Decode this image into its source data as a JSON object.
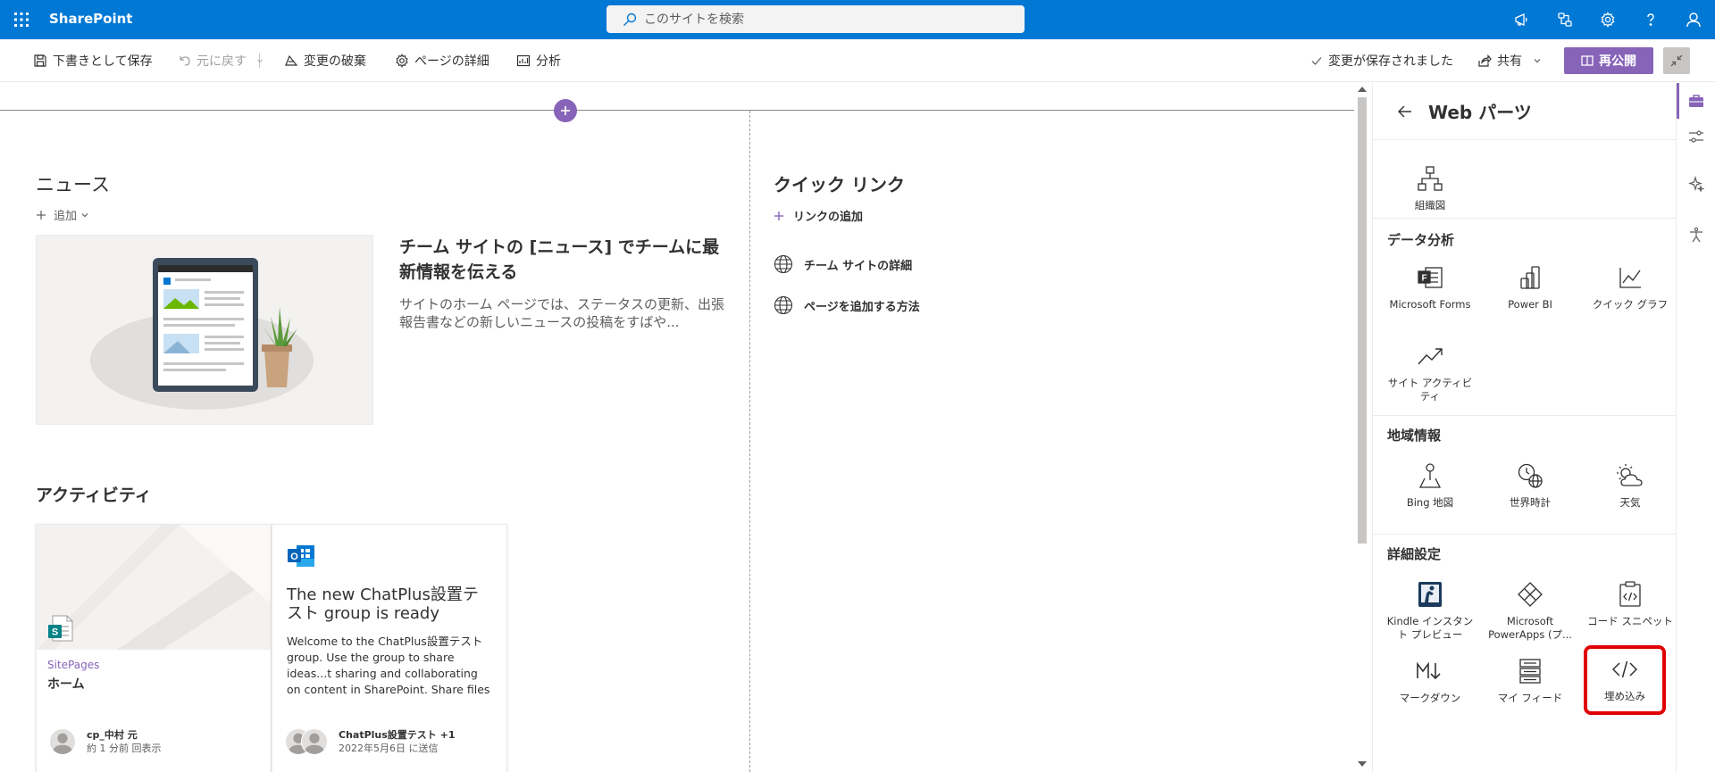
{
  "suite": {
    "brand": "SharePoint",
    "search_placeholder": "このサイトを検索",
    "icons": [
      "megaphone-icon",
      "flow-icon",
      "settings-icon",
      "help-icon",
      "profile-icon"
    ]
  },
  "commandbar": {
    "save_draft": "下書きとして保存",
    "undo": "元に戻す",
    "discard": "変更の破棄",
    "page_details": "ページの詳細",
    "analytics": "分析",
    "saved_status": "変更が保存されました",
    "share": "共有",
    "republish": "再公開"
  },
  "news": {
    "heading": "ニュース",
    "add_label": "追加",
    "title": "チーム サイトの [ニュース] でチームに最新情報を伝える",
    "description": "サイトのホーム ページでは、ステータスの更新、出張報告書などの新しいニュースの投稿をすばや..."
  },
  "quicklinks": {
    "heading": "クイック リンク",
    "add_label": "リンクの追加",
    "items": [
      "チーム サイトの詳細",
      "ページを追加する方法"
    ]
  },
  "activity": {
    "heading": "アクティビティ",
    "cards": [
      {
        "meta": "SitePages",
        "title": "ホーム",
        "person": "cp_中村 元",
        "sub": "約 1 分前 回表示"
      },
      {
        "title": "The new ChatPlus設置テスト group is ready",
        "description": "Welcome to the ChatPlus設置テスト group. Use the group to share ideas...t sharing and collaborating on content in SharePoint. Share files",
        "person": "ChatPlus設置テスト +1",
        "sub": "2022年5月6日 に送信"
      }
    ]
  },
  "toolbox": {
    "title": "Web パーツ",
    "top_items": [
      {
        "label": "組織図",
        "icon": "org-chart-icon"
      }
    ],
    "sections": [
      {
        "title": "データ分析",
        "items": [
          {
            "label": "Microsoft Forms",
            "icon": "forms-icon"
          },
          {
            "label": "Power BI",
            "icon": "power-bi-icon"
          },
          {
            "label": "クイック グラフ",
            "icon": "quick-chart-icon"
          },
          {
            "label": "サイト アクティビティ",
            "icon": "site-activity-icon"
          }
        ]
      },
      {
        "title": "地域情報",
        "items": [
          {
            "label": "Bing 地図",
            "icon": "map-pin-icon"
          },
          {
            "label": "世界時計",
            "icon": "world-clock-icon"
          },
          {
            "label": "天気",
            "icon": "weather-icon"
          }
        ]
      },
      {
        "title": "詳細設定",
        "items": [
          {
            "label": "Kindle インスタント プレビュー",
            "icon": "kindle-icon"
          },
          {
            "label": "Microsoft PowerApps (プ...",
            "icon": "powerapps-icon"
          },
          {
            "label": "コード スニペット",
            "icon": "code-snippet-icon"
          },
          {
            "label": "マークダウン",
            "icon": "markdown-icon"
          },
          {
            "label": "マイ フィード",
            "icon": "my-feed-icon"
          },
          {
            "label": "埋め込み",
            "icon": "embed-icon"
          }
        ]
      }
    ]
  },
  "colors": {
    "suite_bar": "#0078d4",
    "accent": "#8764b8",
    "highlight": "#e00000"
  }
}
